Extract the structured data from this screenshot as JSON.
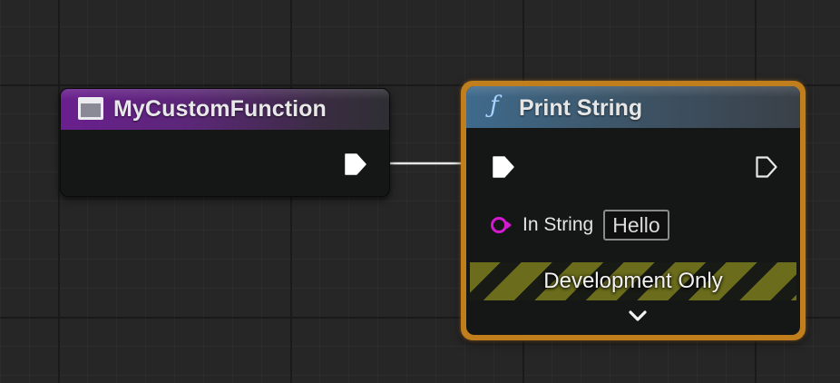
{
  "graph": {
    "background": "#262626"
  },
  "nodes": {
    "custom_function": {
      "title": "MyCustomFunction",
      "header_color": "#6a1f8e",
      "icon": "event-icon"
    },
    "print_string": {
      "icon_glyph": "ƒ",
      "icon": "function-icon",
      "title": "Print String",
      "header_color": "#3f6a8c",
      "border_color": "#c07e1d",
      "in_string": {
        "label": "In String",
        "value": "Hello",
        "pin_color": "#d21ad2"
      },
      "banner": "Development Only",
      "expand_icon": "chevron-down-icon"
    }
  }
}
